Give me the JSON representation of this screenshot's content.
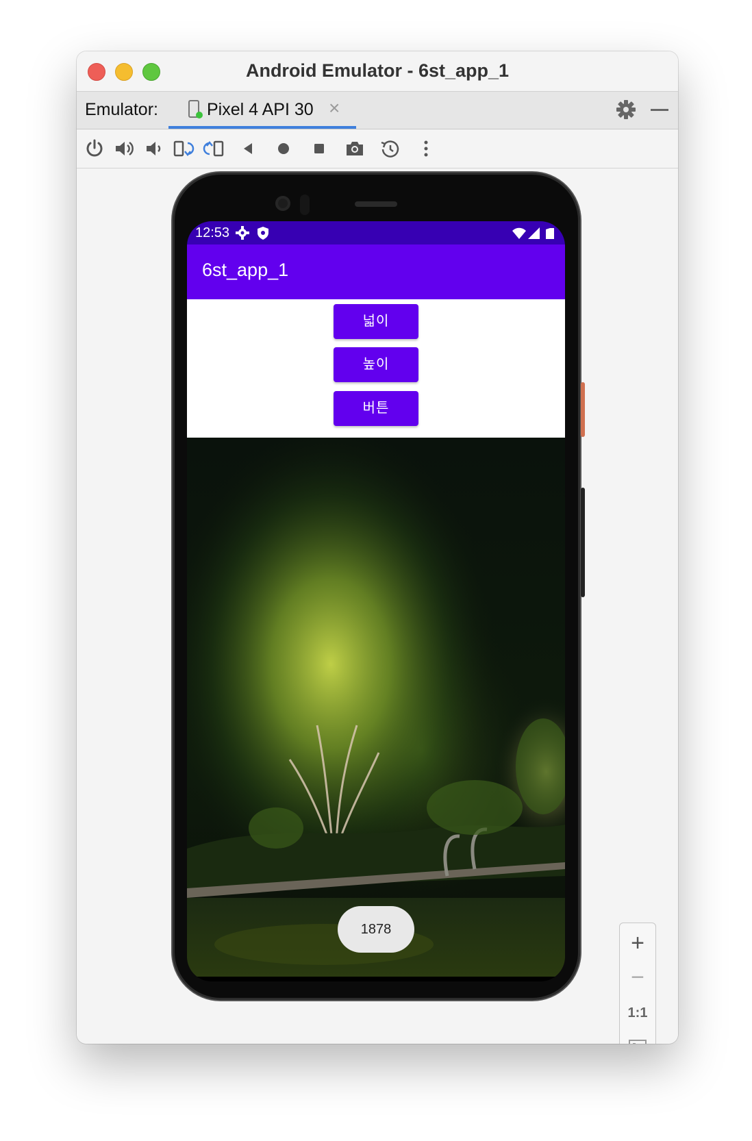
{
  "window": {
    "title": "Android Emulator - 6st_app_1"
  },
  "tabbar": {
    "prefix_label": "Emulator:",
    "tab_label": "Pixel 4 API 30",
    "close_glyph": "×"
  },
  "toolbar": {
    "icons": [
      "power-icon",
      "volume-up-icon",
      "volume-down-icon",
      "rotate-left-icon",
      "rotate-right-icon",
      "back-icon",
      "home-icon",
      "overview-icon",
      "screenshot-icon",
      "snapshot-icon",
      "more-icon"
    ]
  },
  "device": {
    "status_time": "12:53",
    "app_title": "6st_app_1",
    "buttons": [
      "넓이",
      "높이",
      "버튼"
    ],
    "toast_text": "1878"
  },
  "zoom_panel": {
    "plus": "+",
    "minus": "−",
    "one_to_one": "1:1"
  },
  "colors": {
    "status_bar": "#3700b3",
    "app_bar": "#6200ee",
    "button": "#6200ee",
    "tab_underline": "#3f7fdc"
  }
}
